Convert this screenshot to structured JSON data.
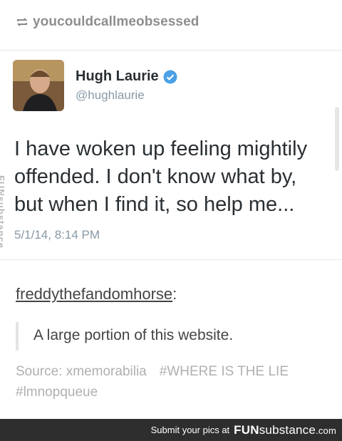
{
  "reblog": {
    "icon": "reblog-icon",
    "username": "youcouldcallmeobsessed"
  },
  "tweet": {
    "display_name": "Hugh Laurie",
    "handle": "@hughlaurie",
    "verified_icon": "verified-badge-icon",
    "verified_color": "#4aa0e6",
    "text": "I have woken up feeling mightily offended. I don't know what by, but when I find it, so help me...",
    "timestamp": "5/1/14, 8:14 PM"
  },
  "watermark": "FUNsubstance",
  "comment": {
    "author": "freddythefandomhorse",
    "colon": ":",
    "quote": "A large portion of this website."
  },
  "meta": {
    "source": "Source: xmemorabilia",
    "tag1": "#WHERE IS THE LIE",
    "tag2": "#lmnopqueue"
  },
  "footer": {
    "text": "Submit your pics at",
    "brand_fun": "FUN",
    "brand_sub": "substance",
    "brand_com": ".com"
  }
}
